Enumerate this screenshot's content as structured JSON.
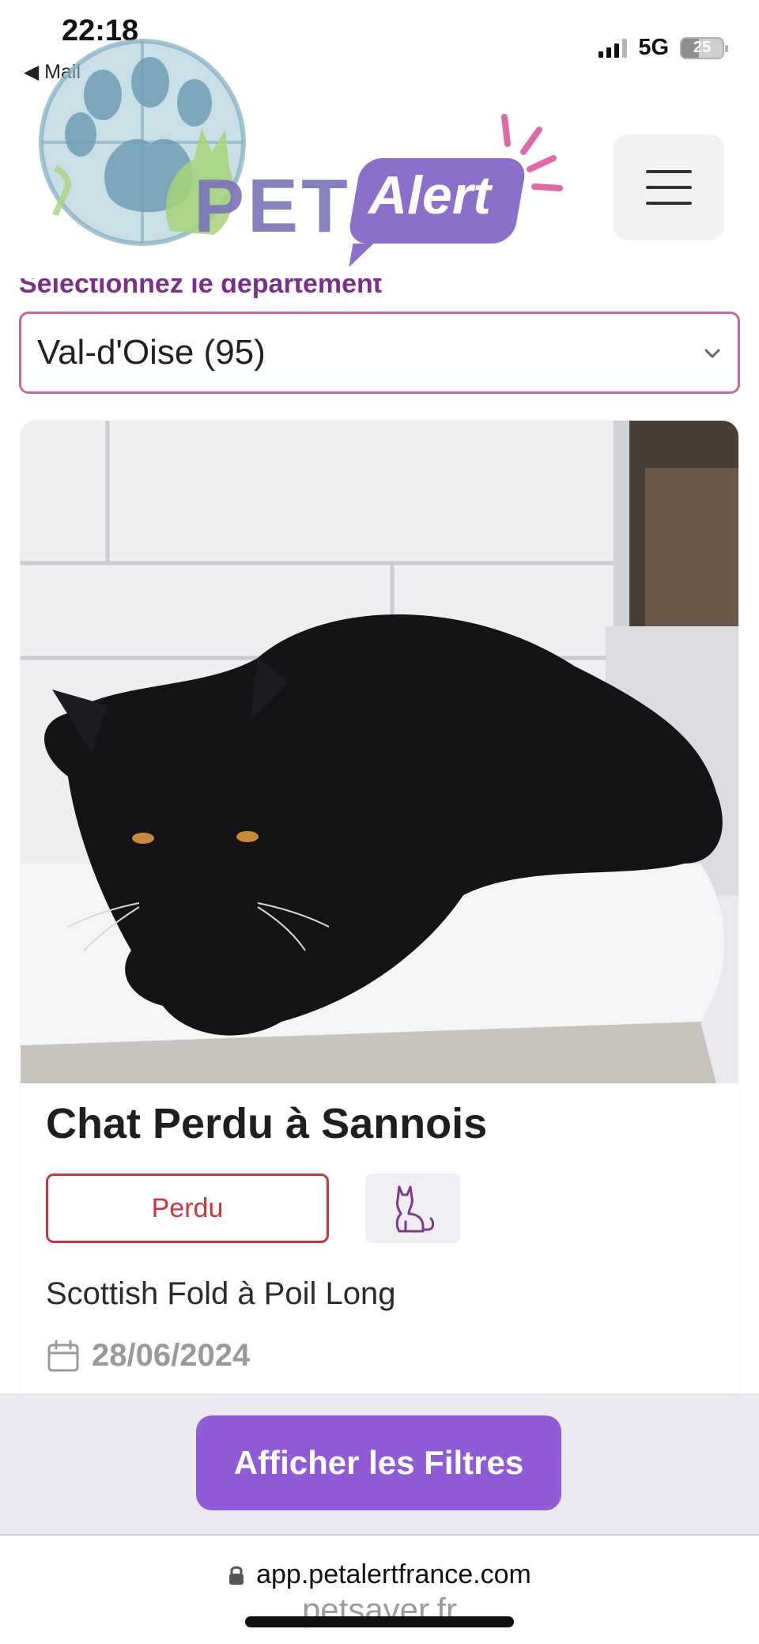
{
  "status_bar": {
    "time": "22:18",
    "back_label": "◀ Mail",
    "network": "5G",
    "battery": "25"
  },
  "header": {
    "logo_word": "PET",
    "logo_accent": "Alert",
    "menu_icon": "hamburger-menu-icon"
  },
  "department": {
    "label": "Sélectionnez le département",
    "selected": "Val-d'Oise (95)"
  },
  "card": {
    "title": "Chat Perdu à Sannois",
    "status": "Perdu",
    "species_icon": "cat-icon",
    "breed": "Scottish Fold à Poil Long",
    "date": "28/06/2024"
  },
  "filters": {
    "button_label": "Afficher les Filtres"
  },
  "browser": {
    "url": "app.petalertfrance.com",
    "watermark": "petsaver.fr"
  },
  "colors": {
    "accent_purple": "#8f5bd6",
    "select_border": "#c9679d",
    "lost_red": "#d0343b",
    "label_purple": "#7a2f8a"
  }
}
